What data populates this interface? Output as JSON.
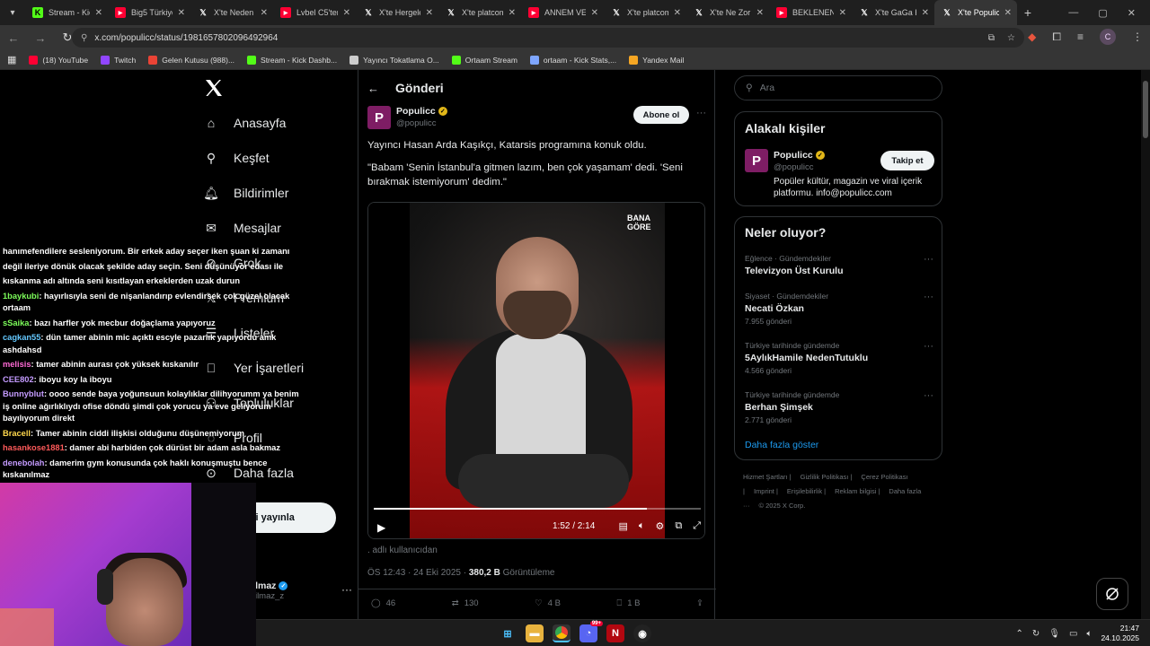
{
  "browser": {
    "tabs": [
      {
        "label": "Stream - Kick",
        "favicon": "kick-icon",
        "color": "#53fc18",
        "active": false
      },
      {
        "label": "Big5 Türkiye",
        "favicon": "youtube-icon",
        "color": "#ff0033",
        "active": false
      },
      {
        "label": "X'te Neden",
        "favicon": "x-icon",
        "color": "#ffffff",
        "active": false
      },
      {
        "label": "Lvbel C5'ten",
        "favicon": "youtube-icon",
        "color": "#ff0033",
        "active": false
      },
      {
        "label": "X'te Hergele",
        "favicon": "x-icon",
        "color": "#ffffff",
        "active": false
      },
      {
        "label": "X'te platcom",
        "favicon": "x-icon",
        "color": "#ffffff",
        "active": false
      },
      {
        "label": "ANNEM VE",
        "favicon": "youtube-icon",
        "color": "#ff0033",
        "active": false
      },
      {
        "label": "X'te platcom",
        "favicon": "x-icon",
        "color": "#ffffff",
        "active": false
      },
      {
        "label": "X'te Ne Zor",
        "favicon": "x-icon",
        "color": "#ffffff",
        "active": false
      },
      {
        "label": "BEKLENEN",
        "favicon": "youtube-icon",
        "color": "#ff0033",
        "active": false
      },
      {
        "label": "X'te GaGa H",
        "favicon": "x-icon",
        "color": "#ffffff",
        "active": false
      },
      {
        "label": "X'te Populicc",
        "favicon": "x-icon",
        "color": "#ffffff",
        "active": true
      }
    ],
    "url": "x.com/populicc/status/1981657802096492964",
    "profile_initial": "C",
    "bookmarks": [
      {
        "label": "(18) YouTube",
        "icon": "youtube-icon",
        "color": "#ff0033"
      },
      {
        "label": "Twitch",
        "icon": "twitch-icon",
        "color": "#9146ff"
      },
      {
        "label": "Gelen Kutusu (988)...",
        "icon": "gmail-icon",
        "color": "#ea4335"
      },
      {
        "label": "Stream - Kick Dashb...",
        "icon": "kick-icon",
        "color": "#53fc18"
      },
      {
        "label": "Yayıncı Tokatlama O...",
        "icon": "globe-icon",
        "color": "#cccccc"
      },
      {
        "label": "Ortaam Stream",
        "icon": "kick-icon",
        "color": "#53fc18"
      },
      {
        "label": "ortaam - Kick Stats,...",
        "icon": "globe-icon",
        "color": "#7ea6ff"
      },
      {
        "label": "Yandex Mail",
        "icon": "mail-icon",
        "color": "#f5a623"
      }
    ]
  },
  "nav": {
    "items": [
      {
        "label": "Anasayfa",
        "icon": "home-icon"
      },
      {
        "label": "Keşfet",
        "icon": "search-icon"
      },
      {
        "label": "Bildirimler",
        "icon": "bell-icon"
      },
      {
        "label": "Mesajlar",
        "icon": "mail-icon"
      },
      {
        "label": "Grok",
        "icon": "grok-icon"
      },
      {
        "label": "Premium",
        "icon": "x-icon"
      },
      {
        "label": "Listeler",
        "icon": "list-icon"
      },
      {
        "label": "Yer İşaretleri",
        "icon": "bookmark-icon"
      },
      {
        "label": "Topluluklar",
        "icon": "people-icon"
      },
      {
        "label": "Profil",
        "icon": "person-icon"
      },
      {
        "label": "Daha fazla",
        "icon": "more-circle-icon"
      }
    ],
    "post_button": "eri yayınla",
    "account_name": "etyilmaz",
    "account_handle": "netyilmaz_z"
  },
  "post": {
    "header_title": "Gönderi",
    "author_name": "Populicc",
    "author_handle": "@populicc",
    "follow_label": "Abone ol",
    "text_1": "Yayıncı Hasan Arda Kaşıkçı, Katarsis programına konuk oldu.",
    "text_2": "\"Babam 'Senin İstanbul'a gitmen lazım, ben çok yaşamam' dedi. 'Seni bırakmak istemiyorum' dedim.\"",
    "video_logo_1": "BANA",
    "video_logo_2": "GÖRE",
    "video_time": "1:52 / 2:14",
    "video_progress": 0.836,
    "source": ". adlı kullanıcıdan",
    "timestamp": "ÖS 12:43 · 24 Eki 2025 · ",
    "views": "380,2 B",
    "views_label": " Görüntüleme",
    "replies": "46",
    "reposts": "130",
    "likes": "4 B",
    "bookmarks": "1 B"
  },
  "sidebar": {
    "search_placeholder": "Ara",
    "related_title": "Alakalı kişiler",
    "related": {
      "name": "Populicc",
      "handle": "@populicc",
      "follow_label": "Takip et",
      "bio": "Popüler kültür, magazin ve viral içerik platformu. info@populicc.com"
    },
    "trends_title": "Neler oluyor?",
    "trends": [
      {
        "context": "Eğlence · Gündemdekiler",
        "name": "Televizyon Üst Kurulu",
        "count": ""
      },
      {
        "context": "Siyaset · Gündemdekiler",
        "name": "Necati Özkan",
        "count": "7.955 gönderi"
      },
      {
        "context": "Türkiye tarihinde gündemde",
        "name": "5AylıkHamile NedenTutuklu",
        "count": "4.566 gönderi"
      },
      {
        "context": "Türkiye tarihinde gündemde",
        "name": "Berhan Şimşek",
        "count": "2.771 gönderi"
      }
    ],
    "show_more": "Daha fazla göster",
    "footer": [
      "Hizmet Şartları |",
      "Gizlilik Politikası |",
      "Çerez Politikası |",
      "Imprint |",
      "Erişilebilirlik |",
      "Reklam bilgisi |",
      "Daha fazla ···",
      "© 2025 X Corp."
    ]
  },
  "chat": [
    {
      "user": "",
      "color": "#ffffff",
      "text": "hanımefendilere sesleniyorum. Bir erkek aday seçer iken şuan ki zamanı"
    },
    {
      "user": "",
      "color": "#ffffff",
      "text": "değil ileriye dönük olacak şekilde aday seçin. Seni düşünüyor edası ile"
    },
    {
      "user": "",
      "color": "#ffffff",
      "text": "kıskanma adı altında seni kısıtlayan erkeklerden uzak durun"
    },
    {
      "user": "1baykubi",
      "color": "#7cfc5a",
      "text": ": hayırlısıyla seni de nişanlandırıp evlendirsek çok güzel olacak ortaam"
    },
    {
      "user": "sSaika",
      "color": "#7cfc5a",
      "text": ": bazı harfler yok mecbur doğaçlama yapıyoruz"
    },
    {
      "user": "cagkan55",
      "color": "#64c8ff",
      "text": ": dün tamer abinin mic açıktı escyle pazarlık yapıyordu amk ashdahsd"
    },
    {
      "user": "melisis",
      "color": "#ff6ad5",
      "text": ": tamer abinin aurası çok yüksek kıskanılır"
    },
    {
      "user": "CEE802",
      "color": "#c49bff",
      "text": ": iboyu koy la iboyu"
    },
    {
      "user": "Bunnyblut",
      "color": "#c49bff",
      "text": ": oooo sende baya yoğunsuun kolaylıklar dilihyorumm ya benim iş online ağırlıklıydı ofise döndü şimdi çok yorucu ya eve geliyorum bayılıyorum direkt"
    },
    {
      "user": "Bracell",
      "color": "#ffd84d",
      "text": ": Tamer abinin ciddi ilişkisi olduğunu düşünemiyorum"
    },
    {
      "user": "hasankose1881",
      "color": "#ff5a5a",
      "text": ": damer abi harbiden çok dürüst bir adam asla bakmaz"
    },
    {
      "user": "denebolah",
      "color": "#c49bff",
      "text": ": damerim gym konusunda çok haklı konuşmuştu bence kıskanılmaz"
    }
  ],
  "taskbar": {
    "time": "21:47",
    "date": "24.10.2025",
    "discord_badge": "99+"
  },
  "colors": {
    "accent": "#1d9bf0",
    "background": "#000000",
    "border": "#2f3336",
    "muted": "#71767b",
    "verified_gold": "#e2b719",
    "populicc_brand": "#7e1d64"
  }
}
